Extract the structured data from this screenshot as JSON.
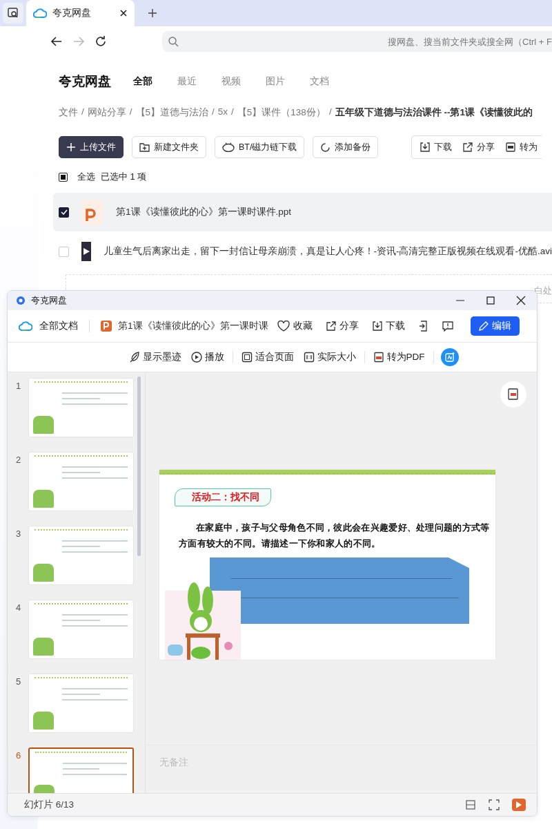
{
  "browser": {
    "tabs": [
      {
        "title": "夸克网盘",
        "selected": true
      }
    ],
    "search": {
      "placeholder": "搜网盘、搜当前文件夹或搜全网（Ctrl + F"
    }
  },
  "drive": {
    "brand": "夸克网盘",
    "nav": [
      {
        "label": "全部",
        "selected": true
      },
      {
        "label": "最近",
        "selected": false
      },
      {
        "label": "视频",
        "selected": false
      },
      {
        "label": "图片",
        "selected": false
      },
      {
        "label": "文档",
        "selected": false
      }
    ],
    "breadcrumb_separator": "/",
    "breadcrumb": [
      "文件",
      "网站分享",
      "【5】道德与法治",
      "5x",
      "【5】课件（138份）",
      "五年级下道德与法治课件 --第1课《读懂彼此的"
    ],
    "actions": [
      {
        "label": "上传文件",
        "kind": "upload"
      },
      {
        "label": "新建文件夹",
        "kind": "folder"
      },
      {
        "label": "BT/磁力链下载",
        "kind": "bt"
      },
      {
        "label": "添加备份",
        "kind": "backup"
      }
    ],
    "selection_actions": [
      {
        "label": "下载",
        "kind": "download"
      },
      {
        "label": "分享",
        "kind": "share"
      },
      {
        "label": "转为",
        "kind": "pdf"
      }
    ],
    "select_all": {
      "label": "全选",
      "indeterminate": true,
      "count": "已选中  1  项"
    },
    "files": [
      {
        "name": "第1课《读懂彼此的心》第一课时课件.ppt",
        "kind": "ppt",
        "selected": true
      },
      {
        "name": "儿童生气后离家出走，留下一封信让母亲崩溃，真是让人心疼！-资讯-高清完整正版视频在线观看-优酷.avi",
        "kind": "video",
        "selected": false
      }
    ],
    "drop_hint": "白处"
  },
  "viewer": {
    "title": "夸克网盘",
    "all_docs": "全部文档",
    "doc_title": "第1课《读懂彼此的心》第一课时课",
    "actions": [
      {
        "label": "收藏",
        "kind": "favorite"
      },
      {
        "label": "分享",
        "kind": "share"
      },
      {
        "label": "下载",
        "kind": "download"
      },
      {
        "kind": "export"
      },
      {
        "kind": "feedback"
      }
    ],
    "edit": "编辑",
    "tools": [
      {
        "label": "显示墨迹",
        "kind": "ink"
      },
      {
        "label": "播放",
        "kind": "play"
      },
      {
        "label": "适合页面",
        "kind": "fit"
      },
      {
        "label": "实际大小",
        "kind": "actual"
      },
      {
        "label": "转为PDF",
        "kind": "pdf"
      }
    ],
    "thumbnails": [
      {
        "number": "1",
        "selected": false
      },
      {
        "number": "2",
        "selected": false
      },
      {
        "number": "3",
        "selected": false
      },
      {
        "number": "4",
        "selected": false
      },
      {
        "number": "5",
        "selected": false
      },
      {
        "number": "6",
        "selected": true
      }
    ],
    "slide": {
      "heading": "活动二：找不同",
      "body": "在家庭中，孩子与父母角色不同，彼此会在兴趣爱好、处理问题的方式等方面有较大的不同。请描述一下你和家人的不同。"
    },
    "notes": "无备注",
    "status": "幻灯片 6/13"
  }
}
